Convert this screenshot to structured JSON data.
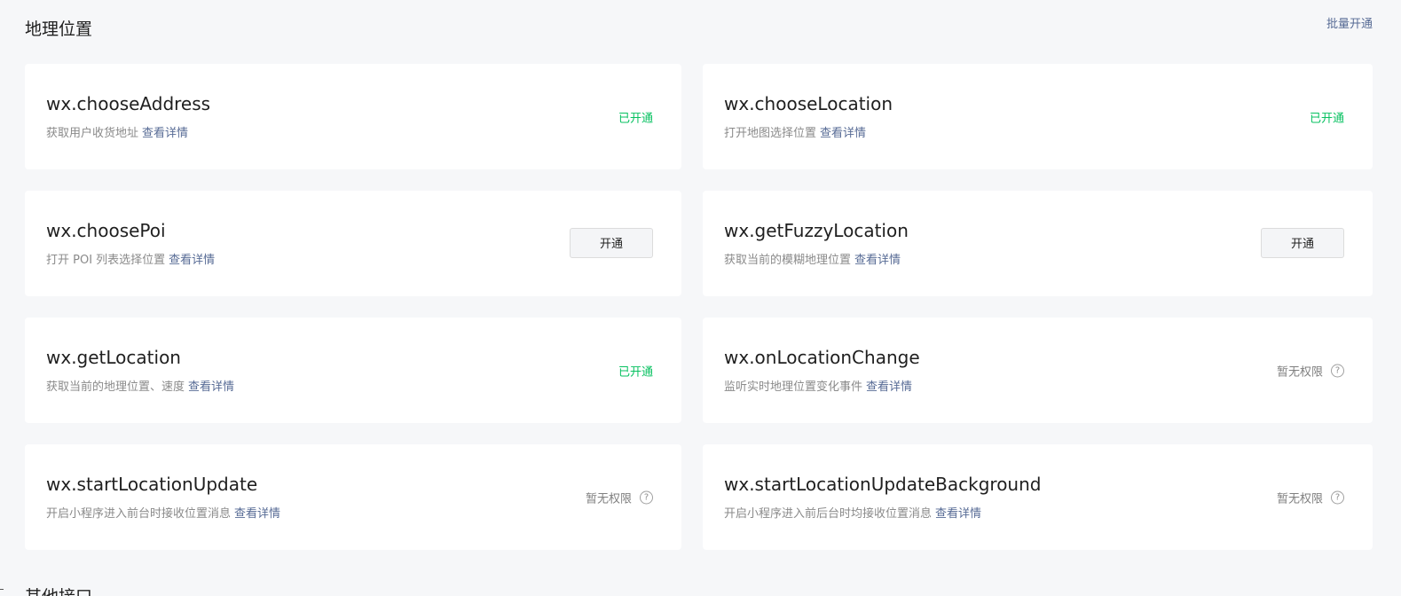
{
  "section": {
    "title": "地理位置",
    "batch_enable_label": "批量开通"
  },
  "detail_link_label": "查看详情",
  "open_button_label": "开通",
  "status_labels": {
    "enabled": "已开通",
    "no_permission": "暂无权限"
  },
  "colors": {
    "enabled": "#07c160",
    "link": "#576b95",
    "background": "#f6f7f9"
  },
  "cards": [
    {
      "name": "wx.chooseAddress",
      "description": "获取用户收货地址",
      "state": "enabled",
      "status_text": "已开通"
    },
    {
      "name": "wx.chooseLocation",
      "description": "打开地图选择位置",
      "state": "enabled",
      "status_text": "已开通"
    },
    {
      "name": "wx.choosePoi",
      "description": "打开 POI 列表选择位置",
      "state": "openable",
      "status_text": "开通"
    },
    {
      "name": "wx.getFuzzyLocation",
      "description": "获取当前的模糊地理位置",
      "state": "openable",
      "status_text": "开通"
    },
    {
      "name": "wx.getLocation",
      "description": "获取当前的地理位置、速度",
      "state": "enabled",
      "status_text": "已开通"
    },
    {
      "name": "wx.onLocationChange",
      "description": "监听实时地理位置变化事件",
      "state": "denied",
      "status_text": "暂无权限"
    },
    {
      "name": "wx.startLocationUpdate",
      "description": "开启小程序进入前台时接收位置消息",
      "state": "denied",
      "status_text": "暂无权限"
    },
    {
      "name": "wx.startLocationUpdateBackground",
      "description": "开启小程序进入前后台时均接收位置消息",
      "state": "denied",
      "status_text": "暂无权限"
    }
  ],
  "help_icon": {
    "name": "question-circle-icon",
    "glyph": "?"
  },
  "next_section": {
    "title": "其他接口"
  }
}
